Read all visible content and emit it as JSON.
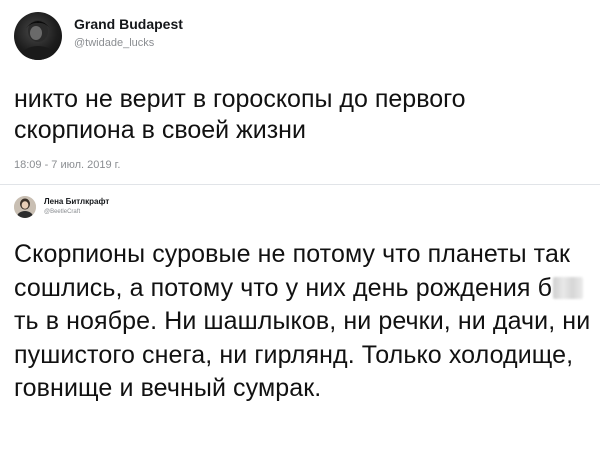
{
  "tweet1": {
    "author_name": "Grand Budapest",
    "author_handle": "@twidade_lucks",
    "text": "никто не верит в гороскопы до первого скорпиона в своей жизни",
    "timestamp": "18:09 - 7 июл. 2019 г.",
    "avatar_icon": "profile-photo-dark"
  },
  "tweet2": {
    "author_name": "Лена Битлкрафт",
    "author_handle": "@BeetleCraft",
    "text_before_censor": "Скорпионы суровые не потому что планеты так сошлись, а потому что у них день рождения б",
    "text_after_censor": "ть в ноябре. Ни шашлыков, ни речки, ни дачи, ни пушистого снега, ни гирлянд. Только холодище, говнище и вечный сумрак.",
    "avatar_icon": "profile-photo-light",
    "censor_icon": "blurred-censor-patch"
  },
  "colors": {
    "background": "#ffffff",
    "text": "#111111",
    "secondary_text": "#8a8d91",
    "divider": "#e1e4e8"
  }
}
